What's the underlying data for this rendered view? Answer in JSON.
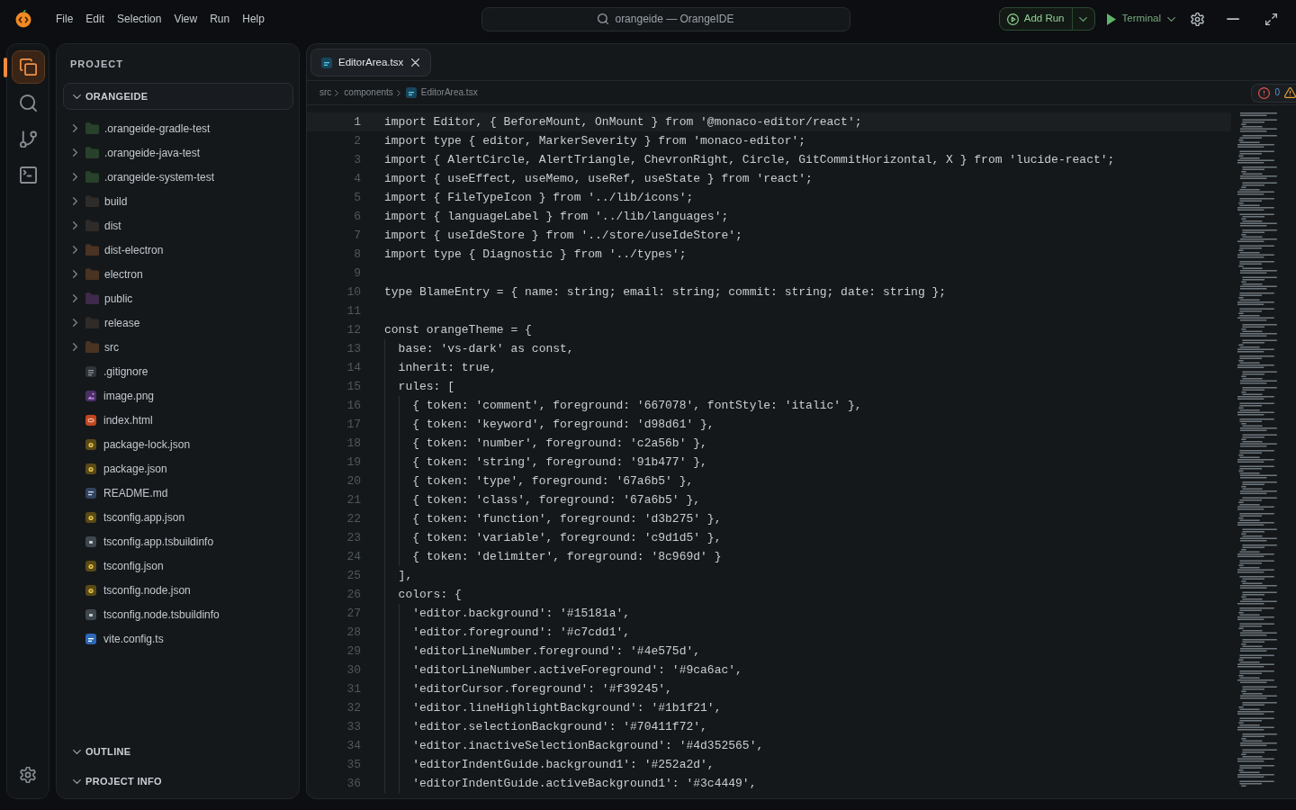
{
  "menu": [
    "File",
    "Edit",
    "Selection",
    "View",
    "Run",
    "Help"
  ],
  "command_center": {
    "title": "orangeide — OrangeIDE"
  },
  "run_controls": {
    "add_run": "Add Run",
    "terminal": "Terminal"
  },
  "activity_bar": {
    "items": [
      {
        "kind": "files",
        "selected": true
      },
      {
        "kind": "search",
        "selected": false
      },
      {
        "kind": "git",
        "selected": false
      },
      {
        "kind": "terminal",
        "selected": false
      }
    ]
  },
  "sidebar": {
    "title": "PROJECT",
    "root": {
      "name": "ORANGEIDE",
      "expanded": true,
      "children": [
        {
          "name": ".orangeide-gradle-test",
          "kind": "folder",
          "color": "#27412b",
          "expanded": false
        },
        {
          "name": ".orangeide-java-test",
          "kind": "folder",
          "color": "#27412b",
          "expanded": false
        },
        {
          "name": ".orangeide-system-test",
          "kind": "folder",
          "color": "#27412b",
          "expanded": false
        },
        {
          "name": "build",
          "kind": "folder",
          "color": "#2e2b28",
          "expanded": false
        },
        {
          "name": "dist",
          "kind": "folder",
          "color": "#2e2b28",
          "expanded": false
        },
        {
          "name": "dist-electron",
          "kind": "folder",
          "color": "#4a3322",
          "expanded": false
        },
        {
          "name": "electron",
          "kind": "folder",
          "color": "#4a3322",
          "expanded": false
        },
        {
          "name": "public",
          "kind": "folder",
          "color": "#3e2a4a",
          "expanded": false
        },
        {
          "name": "release",
          "kind": "folder",
          "color": "#2e2b28",
          "expanded": false
        },
        {
          "name": "src",
          "kind": "folder",
          "color": "#4a3322",
          "expanded": false
        },
        {
          "name": ".gitignore",
          "kind": "text"
        },
        {
          "name": "image.png",
          "kind": "image"
        },
        {
          "name": "index.html",
          "kind": "html"
        },
        {
          "name": "package-lock.json",
          "kind": "json"
        },
        {
          "name": "package.json",
          "kind": "json"
        },
        {
          "name": "README.md",
          "kind": "markdown"
        },
        {
          "name": "tsconfig.app.json",
          "kind": "json"
        },
        {
          "name": "tsconfig.app.tsbuildinfo",
          "kind": "buildinfo"
        },
        {
          "name": "tsconfig.json",
          "kind": "json"
        },
        {
          "name": "tsconfig.node.json",
          "kind": "json"
        },
        {
          "name": "tsconfig.node.tsbuildinfo",
          "kind": "buildinfo"
        },
        {
          "name": "vite.config.ts",
          "kind": "typescript"
        }
      ]
    },
    "sections": [
      {
        "title": "OUTLINE",
        "expanded": true
      },
      {
        "title": "PROJECT INFO",
        "expanded": true
      }
    ]
  },
  "editor": {
    "tabs": [
      {
        "label": "EditorArea.tsx",
        "kind": "tsx",
        "selected": true
      }
    ],
    "breadcrumb": [
      {
        "label": "src",
        "kind": "folder"
      },
      {
        "label": "components",
        "kind": "folder"
      },
      {
        "label": "EditorArea.tsx",
        "kind": "tsx"
      }
    ],
    "problems": {
      "errors": "0"
    },
    "lines": [
      {
        "number": "1",
        "text": "import Editor, { BeforeMount, OnMount } from '@monaco-editor/react';",
        "active": true
      },
      {
        "number": "2",
        "text": "import type { editor, MarkerSeverity } from 'monaco-editor';",
        "active": false
      },
      {
        "number": "3",
        "text": "import { AlertCircle, AlertTriangle, ChevronRight, Circle, GitCommitHorizontal, X } from 'lucide-react';",
        "active": false
      },
      {
        "number": "4",
        "text": "import { useEffect, useMemo, useRef, useState } from 'react';",
        "active": false
      },
      {
        "number": "5",
        "text": "import { FileTypeIcon } from '../lib/icons';",
        "active": false
      },
      {
        "number": "6",
        "text": "import { languageLabel } from '../lib/languages';",
        "active": false
      },
      {
        "number": "7",
        "text": "import { useIdeStore } from '../store/useIdeStore';",
        "active": false
      },
      {
        "number": "8",
        "text": "import type { Diagnostic } from '../types';",
        "active": false
      },
      {
        "number": "9",
        "active": false
      },
      {
        "number": "10",
        "text": "type BlameEntry = { name: string; email: string; commit: string; date: string };",
        "active": false
      },
      {
        "number": "11",
        "active": false
      },
      {
        "number": "12",
        "text": "const orangeTheme = {",
        "active": false
      },
      {
        "number": "13",
        "text": "  base: 'vs-dark' as const,",
        "active": false
      },
      {
        "number": "14",
        "text": "  inherit: true,",
        "active": false
      },
      {
        "number": "15",
        "text": "  rules: [",
        "active": false
      },
      {
        "number": "16",
        "text": "    { token: 'comment', foreground: '667078', fontStyle: 'italic' },",
        "active": false
      },
      {
        "number": "17",
        "text": "    { token: 'keyword', foreground: 'd98d61' },",
        "active": false
      },
      {
        "number": "18",
        "text": "    { token: 'number', foreground: 'c2a56b' },",
        "active": false
      },
      {
        "number": "19",
        "text": "    { token: 'string', foreground: '91b477' },",
        "active": false
      },
      {
        "number": "20",
        "text": "    { token: 'type', foreground: '67a6b5' },",
        "active": false
      },
      {
        "number": "21",
        "text": "    { token: 'class', foreground: '67a6b5' },",
        "active": false
      },
      {
        "number": "22",
        "text": "    { token: 'function', foreground: 'd3b275' },",
        "active": false
      },
      {
        "number": "23",
        "text": "    { token: 'variable', foreground: 'c9d1d5' },",
        "active": false
      },
      {
        "number": "24",
        "text": "    { token: 'delimiter', foreground: '8c969d' }",
        "active": false
      },
      {
        "number": "25",
        "text": "  ],",
        "active": false
      },
      {
        "number": "26",
        "text": "  colors: {",
        "active": false
      },
      {
        "number": "27",
        "text": "    'editor.background': '#15181a',",
        "active": false
      },
      {
        "number": "28",
        "text": "    'editor.foreground': '#c7cdd1',",
        "active": false
      },
      {
        "number": "29",
        "text": "    'editorLineNumber.foreground': '#4e575d',",
        "active": false
      },
      {
        "number": "30",
        "text": "    'editorLineNumber.activeForeground': '#9ca6ac',",
        "active": false
      },
      {
        "number": "31",
        "text": "    'editorCursor.foreground': '#f39245',",
        "active": false
      },
      {
        "number": "32",
        "text": "    'editor.lineHighlightBackground': '#1b1f21',",
        "active": false
      },
      {
        "number": "33",
        "text": "    'editor.selectionBackground': '#70411f72',",
        "active": false
      },
      {
        "number": "34",
        "text": "    'editor.inactiveSelectionBackground': '#4d352565',",
        "active": false
      },
      {
        "number": "35",
        "text": "    'editorIndentGuide.background1': '#252a2d',",
        "active": false
      },
      {
        "number": "36",
        "text": "    'editorIndentGuide.activeBackground1': '#3c4449',",
        "active": false
      }
    ]
  }
}
